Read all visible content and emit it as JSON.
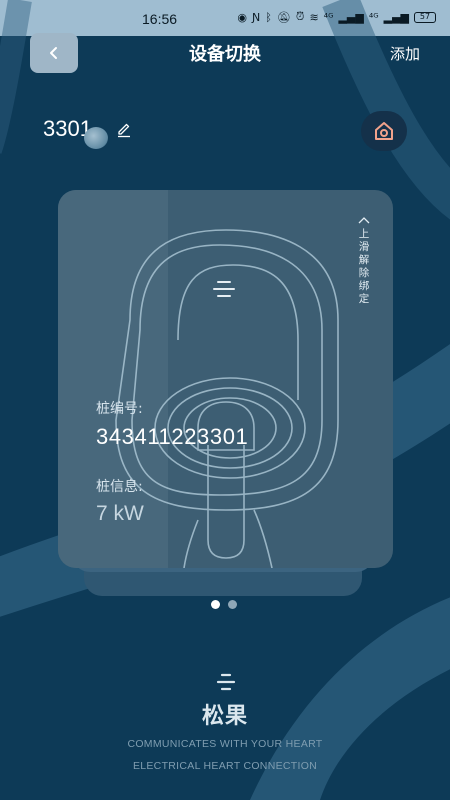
{
  "status_bar": {
    "time": "16:56",
    "icons": [
      "eye-icon",
      "nfc-icon",
      "bluetooth-icon",
      "mute-icon",
      "alarm-icon",
      "wifi-icon",
      "signal-icon",
      "signal-icon"
    ],
    "network_labels": [
      "⁴ᴳ",
      "⁴ᴳ"
    ],
    "battery": "57"
  },
  "header": {
    "title": "设备切换",
    "add_label": "添加",
    "back_icon": "chevron-left-icon"
  },
  "device": {
    "name": "3301",
    "edit_icon": "pencil-icon",
    "home_icon": "home-icon"
  },
  "card": {
    "unbind_hint": "上滑解除绑定",
    "pile_number_label": "桩编号:",
    "pile_number": "343411223301",
    "pile_info_label": "桩信息:",
    "pile_power": "7 kW"
  },
  "pager": {
    "count": 2,
    "active_index": 0
  },
  "brand": {
    "name": "松果",
    "slogan_line1": "COMMUNICATES WITH YOUR HEART",
    "slogan_line2": "ELECTRICAL HEART CONNECTION"
  },
  "colors": {
    "background": "#0d3a57",
    "card": "#3d5e73",
    "status_bar": "#9fbdd1",
    "back_button": "#9fb6c7",
    "home_button": "#14314a",
    "accent_icon": "#f1a28b"
  }
}
